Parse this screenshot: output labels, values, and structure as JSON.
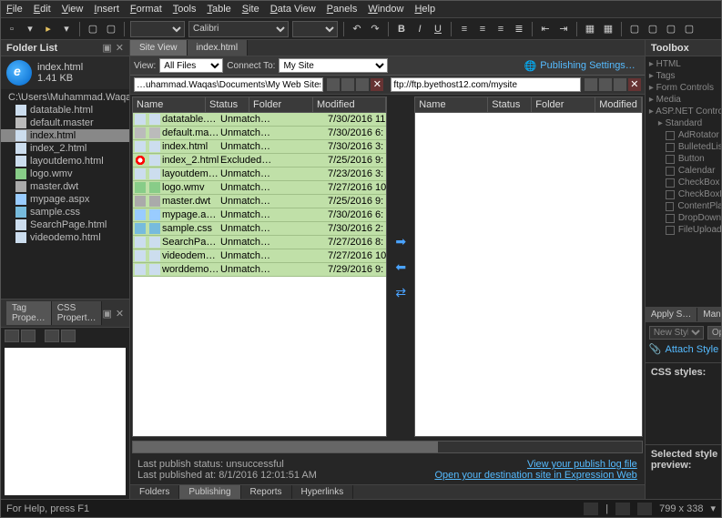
{
  "menu": [
    "File",
    "Edit",
    "View",
    "Insert",
    "Format",
    "Tools",
    "Table",
    "Site",
    "Data View",
    "Panels",
    "Window",
    "Help"
  ],
  "font_family": "Calibri",
  "folder_list": {
    "title": "Folder List",
    "current_file": "index.html",
    "current_size": "1.41 KB",
    "root_path": "C:\\Users\\Muhammad.Waqas\\Docum…",
    "items": [
      {
        "name": "datatable.html",
        "type": "html"
      },
      {
        "name": "default.master",
        "type": "master"
      },
      {
        "name": "index.html",
        "type": "html",
        "sel": true
      },
      {
        "name": "index_2.html",
        "type": "html"
      },
      {
        "name": "layoutdemo.html",
        "type": "html"
      },
      {
        "name": "logo.wmv",
        "type": "wmv"
      },
      {
        "name": "master.dwt",
        "type": "dwt"
      },
      {
        "name": "mypage.aspx",
        "type": "aspx"
      },
      {
        "name": "sample.css",
        "type": "css"
      },
      {
        "name": "SearchPage.html",
        "type": "html"
      },
      {
        "name": "videodemo.html",
        "type": "html"
      }
    ]
  },
  "tag_panel": {
    "tabs": [
      "Tag Prope…",
      "CSS Propert…"
    ]
  },
  "doc_tabs": [
    "Site View",
    "index.html"
  ],
  "view_bar": {
    "view_label": "View:",
    "view_value": "All Files",
    "connect_label": "Connect To:",
    "connect_value": "My Site",
    "pub_settings": "Publishing Settings…"
  },
  "local_path": "…uhammad.Waqas\\Documents\\My Web Sites\\mysite",
  "remote_path": "ftp://ftp.byethost12.com/mysite",
  "file_headers": [
    "Name",
    "Status",
    "Folder",
    "Modified"
  ],
  "local_files": [
    {
      "name": "datatable.html",
      "status": "Unmatch…",
      "mod": "7/30/2016 11",
      "type": "html"
    },
    {
      "name": "default.master",
      "status": "Unmatch…",
      "mod": "7/30/2016 6:",
      "type": "master"
    },
    {
      "name": "index.html",
      "status": "Unmatch…",
      "mod": "7/30/2016 3:",
      "type": "html"
    },
    {
      "name": "index_2.html",
      "status": "Excluded…",
      "mod": "7/25/2016 9:",
      "type": "html",
      "excluded": true
    },
    {
      "name": "layoutdemo…",
      "status": "Unmatch…",
      "mod": "7/23/2016 3:",
      "type": "html"
    },
    {
      "name": "logo.wmv",
      "status": "Unmatch…",
      "mod": "7/27/2016 10",
      "type": "wmv"
    },
    {
      "name": "master.dwt",
      "status": "Unmatch…",
      "mod": "7/25/2016 9:",
      "type": "dwt"
    },
    {
      "name": "mypage.aspx",
      "status": "Unmatch…",
      "mod": "7/30/2016 6:",
      "type": "aspx"
    },
    {
      "name": "sample.css",
      "status": "Unmatch…",
      "mod": "7/30/2016 2:",
      "type": "css"
    },
    {
      "name": "SearchPage…",
      "status": "Unmatch…",
      "mod": "7/27/2016 8:",
      "type": "html"
    },
    {
      "name": "videodemo…",
      "status": "Unmatch…",
      "mod": "7/27/2016 10",
      "type": "html"
    },
    {
      "name": "worddemo.h…",
      "status": "Unmatch…",
      "mod": "7/29/2016 9:",
      "type": "html"
    }
  ],
  "publish_status": {
    "line1": "Last publish status: unsuccessful",
    "line2": "Last published at: 8/1/2016 12:01:51 AM",
    "link1": "View your publish log file",
    "link2": "Open your destination site in Expression Web"
  },
  "bottom_tabs": [
    "Folders",
    "Publishing",
    "Reports",
    "Hyperlinks"
  ],
  "toolbox": {
    "title": "Toolbox",
    "groups": [
      "HTML",
      "Tags",
      "Form Controls",
      "Media",
      "ASP.NET Controls"
    ],
    "standard": "Standard",
    "items": [
      "AdRotator",
      "BulletedList",
      "Button",
      "Calendar",
      "CheckBox",
      "CheckBoxList",
      "ContentPlaceHolder",
      "DropDownList",
      "FileUpload"
    ]
  },
  "apply": {
    "tabs": [
      "Apply S…",
      "Man…"
    ],
    "new_style": "New Style…",
    "options": "Options",
    "attach": "Attach Style Sheet…",
    "css_title": "CSS styles:",
    "sel_title": "Selected style preview:"
  },
  "statusbar": {
    "help": "For Help, press F1",
    "dims": "799 x 338"
  }
}
